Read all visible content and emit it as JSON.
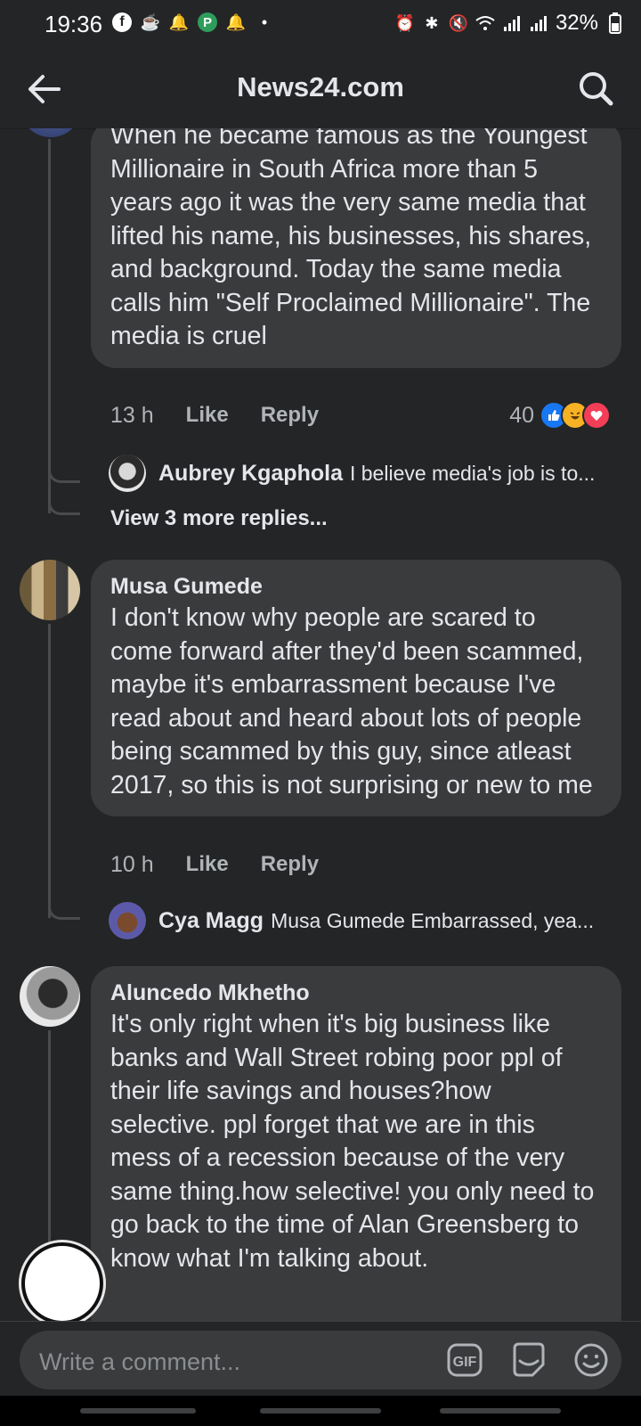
{
  "status_bar": {
    "time": "19:36",
    "battery": "32%"
  },
  "header": {
    "title": "News24.com"
  },
  "comment1": {
    "text": "When he became famous as the Youngest Millionaire in South Africa more than 5 years ago it was the very same media that lifted his name, his businesses, his shares, and background. Today the same media calls him \"Self Proclaimed Millionaire\". The media is cruel",
    "time": "13 h",
    "like": "Like",
    "reply": "Reply",
    "reactions_count": "40",
    "reply_preview": {
      "name": "Aubrey Kgaphola",
      "text": "I believe media's job is to..."
    },
    "view_more": "View 3 more replies..."
  },
  "comment2": {
    "name": "Musa Gumede",
    "text": "I don't know why people are scared to come forward after they'd been scammed, maybe it's embarrassment because I've read about and heard about lots of people being scammed by this guy, since atleast 2017, so this is not surprising or new to me",
    "time": "10 h",
    "like": "Like",
    "reply": "Reply",
    "reply_preview": {
      "name": "Cya Magg",
      "text": "Musa Gumede Embarrassed, yea..."
    }
  },
  "comment3": {
    "name": "Aluncedo Mkhetho",
    "text": "It's only right when it's big business like banks and Wall Street robing poor ppl of their life savings and houses?how selective. ppl forget that we are in this mess of a recession because of the very same  thing.how selective! you only need to go back to the time of Alan Greensberg to know what I'm talking about."
  },
  "composer": {
    "placeholder": "Write a comment...",
    "gif_label": "GIF"
  },
  "colors": {
    "background": "#242526",
    "bubble": "#3a3b3c",
    "text": "#e4e6eb",
    "muted": "#b0b3b8",
    "like_blue": "#1877f2"
  }
}
